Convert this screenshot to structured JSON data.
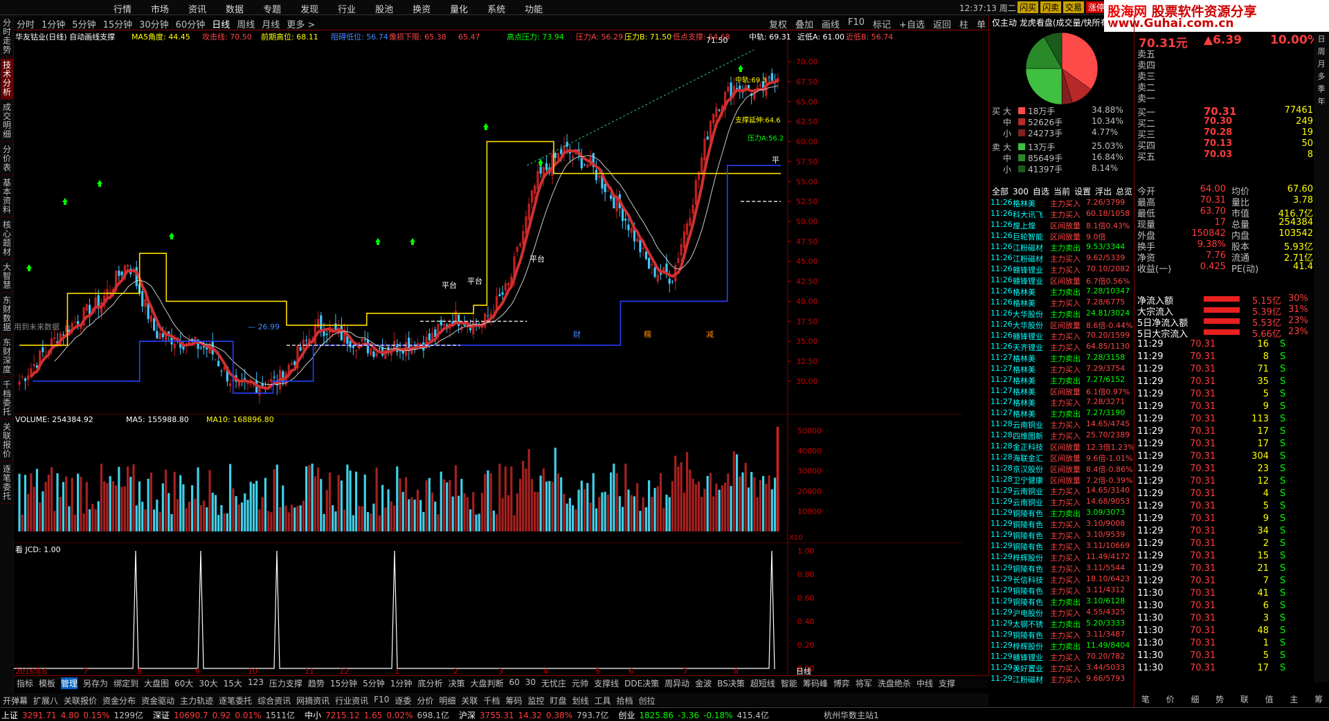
{
  "menubar": {
    "items": [
      "行情",
      "市场",
      "资讯",
      "数据",
      "专题",
      "发现",
      "行业",
      "股池",
      "换资",
      "量化",
      "系统",
      "功能"
    ],
    "clock": "12:37:13 周二",
    "buttons": [
      "闪买",
      "闪卖",
      "交易",
      "涨停买"
    ]
  },
  "logo": {
    "line1a": "股海网",
    "line1b": "股票软件资源分享",
    "line2": "www.Guhai.com.cn"
  },
  "left_tabs": [
    "分时走势",
    "技术分析",
    "成交明细",
    "分价表",
    "基本资料",
    "核心题材",
    "大智慧",
    "东财数据",
    "东财深度",
    "千档委托",
    "关联报价",
    "逐笔委托"
  ],
  "chart_toolbar": {
    "periods": [
      "分时",
      "1分钟",
      "5分钟",
      "15分钟",
      "30分钟",
      "60分钟",
      "日线",
      "周线",
      "月线",
      "更多 >"
    ],
    "right": [
      "复权",
      "叠加",
      "画线",
      "F10",
      "标记",
      "+自选",
      "返回",
      "柱",
      "单"
    ]
  },
  "indicator_line": {
    "name": "华友钴业(日线) 自动画线支撑",
    "ma5": "MA5角度: 44.45",
    "attack": "攻击线: 70.50",
    "prev_high": "前期高位: 68.11",
    "pos": "阻碍低位: 56.74",
    "break": "像损下限: 65.38",
    "dn": "65.47",
    "high_press": "高点压力: 73.94",
    "pa": "压力A: 56.29",
    "pb": "压力B: 71.50",
    "low_sup": "低点支撑: 64.68",
    "mid": "中轨: 69.31",
    "near_a": "近低A: 61.00",
    "near_b": "近低B: 56.74"
  },
  "main_axis": [
    "70.00",
    "67.50",
    "65.00",
    "62.50",
    "60.00",
    "57.50",
    "55.00",
    "52.50",
    "50.00",
    "47.50",
    "45.00",
    "42.50",
    "40.00",
    "37.50",
    "35.00",
    "32.50",
    "30.00"
  ],
  "main_labels": {
    "pingtai": "平台",
    "low": "26.99",
    "high": "71.50",
    "watermark": "用到未来数据",
    "support": "支撑延伸:64.6",
    "pressA": "压力A:56.2",
    "mid": "中轨:69.3",
    "cai": "财",
    "duo": "糯",
    "jian": "减",
    "ping": "平"
  },
  "vol": {
    "title": "VOLUME: 254384.92",
    "ma5": "MA5: 155988.80",
    "ma10": "MA10: 168896.80",
    "axis": [
      "50000",
      "40000",
      "30000",
      "20000",
      "10000"
    ],
    "x10": "X10"
  },
  "jcd": {
    "title": "看  JCD: 1.00",
    "axis": [
      "1.00",
      "0.80",
      "0.60",
      "0.40",
      "0.20",
      "0.00"
    ]
  },
  "date_axis": [
    "2016年6",
    "7",
    "8",
    "9",
    "10",
    "11",
    "12",
    "1",
    "2",
    "3",
    "4",
    "5",
    "6",
    "7",
    "8"
  ],
  "date_right": "日线",
  "bottom_tools": [
    "指标",
    "模板",
    "管理",
    "另存为",
    "绑定到",
    "大盘图",
    "60大",
    "30大",
    "15大",
    "123",
    "压力支撑",
    "趋势",
    "15分钟",
    "5分钟",
    "1分钟",
    "底分析",
    "决策",
    "大盘判断",
    "60",
    "30",
    "无忧庄",
    "元帅",
    "支撑线",
    "DDE决策",
    "周异动",
    "金波",
    "BS决策",
    "超短线",
    "智能",
    "筹码峰",
    "博弈",
    "将军",
    "洗盘绝杀",
    "中线",
    "支撑"
  ],
  "bottom_tools2": [
    "开弹幕",
    "扩展八",
    "关联报价",
    "资金分布",
    "资金驱动",
    "主力轨迹",
    "逐笔委托",
    "综合资讯",
    "网摘资讯",
    "行业资讯",
    "F10",
    "逐委",
    "分价",
    "明细",
    "关联",
    "千档",
    "筹码",
    "监控",
    "盯盘",
    "划线",
    "工具",
    "拾档",
    "创拉"
  ],
  "pie": {
    "title": "仅主动 龙虎看盘(成交量/快所有)",
    "buy_label": "买",
    "sell_label": "卖",
    "buy": [
      {
        "k": "大",
        "v": "18万手",
        "p": "34.88%"
      },
      {
        "k": "中",
        "v": "52626手",
        "p": "10.34%"
      },
      {
        "k": "小",
        "v": "24273手",
        "p": "4.77%"
      }
    ],
    "sell": [
      {
        "k": "大",
        "v": "13万手",
        "p": "25.03%"
      },
      {
        "k": "中",
        "v": "85649手",
        "p": "16.84%"
      },
      {
        "k": "小",
        "v": "41397手",
        "p": "8.14%"
      }
    ],
    "colors": [
      "#ff4a4a",
      "#b82828",
      "#802020",
      "#40c040",
      "#2a8a2a",
      "#1a5a1a"
    ]
  },
  "news_tabs": [
    "全部",
    "300",
    "自选",
    "当前",
    "设置",
    "浮出",
    "总览"
  ],
  "news": [
    [
      "11:26",
      "格林美",
      "主力买入",
      "7.26/3799"
    ],
    [
      "11:26",
      "科大讯飞",
      "主力买入",
      "60.18/1058"
    ],
    [
      "11:26",
      "煌上煌",
      "区间放量",
      "8.1倍0.43%"
    ],
    [
      "11:26",
      "巨轮智能",
      "区间放量",
      "9.0倍"
    ],
    [
      "11:26",
      "江粉磁材",
      "主力卖出",
      "9.53/3344"
    ],
    [
      "11:26",
      "江粉磁材",
      "主力买入",
      "9.62/5339"
    ],
    [
      "11:26",
      "赣锋锂业",
      "主力买入",
      "70.10/2082"
    ],
    [
      "11:26",
      "赣锋锂业",
      "区间放量",
      "6.7倍0.56%"
    ],
    [
      "11:26",
      "格林美",
      "主力卖出",
      "7.28/10347"
    ],
    [
      "11:26",
      "格林美",
      "主力买入",
      "7.28/6775"
    ],
    [
      "11:26",
      "大华股份",
      "主力卖出",
      "24.81/3024"
    ],
    [
      "11:26",
      "大华股份",
      "区间放量",
      "8.6倍-0.44%"
    ],
    [
      "11:26",
      "赣锋锂业",
      "主力买入",
      "70.20/1599"
    ],
    [
      "11:26",
      "天齐锂业",
      "主力买入",
      "64.85/1130"
    ],
    [
      "11:27",
      "格林美",
      "主力卖出",
      "7.28/3158"
    ],
    [
      "11:27",
      "格林美",
      "主力买入",
      "7.29/3754"
    ],
    [
      "11:27",
      "格林美",
      "主力卖出",
      "7.27/6152"
    ],
    [
      "11:27",
      "格林美",
      "区间放量",
      "6.1倍0.97%"
    ],
    [
      "11:27",
      "格林美",
      "主力买入",
      "7.28/3271"
    ],
    [
      "11:27",
      "格林美",
      "主力卖出",
      "7.27/3190"
    ],
    [
      "11:28",
      "云南铜业",
      "主力买入",
      "14.65/4745"
    ],
    [
      "11:28",
      "四维图新",
      "主力买入",
      "25.70/2389"
    ],
    [
      "11:28",
      "金正科技",
      "区间放量",
      "12.3倍1.23%"
    ],
    [
      "11:28",
      "海联金汇",
      "区间放量",
      "9.6倍-1.01%"
    ],
    [
      "11:28",
      "京汉股份",
      "区间放量",
      "8.4倍-0.86%"
    ],
    [
      "11:28",
      "卫宁健康",
      "区间放量",
      "7.2倍-0.39%"
    ],
    [
      "11:29",
      "云南铜业",
      "主力买入",
      "14.65/3140"
    ],
    [
      "11:29",
      "云南铜业",
      "主力买入",
      "14.68/9053"
    ],
    [
      "11:29",
      "铜陵有色",
      "主力卖出",
      "3.09/3073"
    ],
    [
      "11:29",
      "铜陵有色",
      "主力买入",
      "3.10/9008"
    ],
    [
      "11:29",
      "铜陵有色",
      "主力买入",
      "3.10/9539"
    ],
    [
      "11:29",
      "铜陵有色",
      "主力买入",
      "3.11/10669"
    ],
    [
      "11:29",
      "梓辉股份",
      "主力买入",
      "11.49/4172"
    ],
    [
      "11:29",
      "铜陵有色",
      "主力买入",
      "3.11/5544"
    ],
    [
      "11:29",
      "长信科技",
      "主力买入",
      "18.10/6423"
    ],
    [
      "11:29",
      "铜陵有色",
      "主力买入",
      "3.11/4312"
    ],
    [
      "11:29",
      "铜陵有色",
      "主力卖出",
      "3.10/6128"
    ],
    [
      "11:29",
      "沪电股份",
      "主力买入",
      "4.55/4325"
    ],
    [
      "11:29",
      "太钢不锈",
      "主力卖出",
      "5.20/3333"
    ],
    [
      "11:29",
      "铜陵有色",
      "主力买入",
      "3.11/3487"
    ],
    [
      "11:29",
      "梓辉股份",
      "主力卖出",
      "11.49/8404"
    ],
    [
      "11:29",
      "赣锋锂业",
      "主力买入",
      "70.20/782"
    ],
    [
      "11:29",
      "美好置业",
      "主力买入",
      "3.44/5033"
    ],
    [
      "11:29",
      "江粉磁材",
      "主力买入",
      "9.66/5793"
    ]
  ],
  "quote": {
    "name": "华",
    "price": "70.31元",
    "change": "▲6.39",
    "pct": "10.00%"
  },
  "asks": [
    [
      "卖五",
      "",
      ""
    ],
    [
      "卖四",
      "",
      ""
    ],
    [
      "卖三",
      "",
      ""
    ],
    [
      "卖二",
      "",
      ""
    ],
    [
      "卖一",
      "",
      ""
    ]
  ],
  "bids": [
    [
      "买一",
      "70.31",
      "77461"
    ],
    [
      "买二",
      "70.30",
      "249"
    ],
    [
      "买三",
      "70.28",
      "19"
    ],
    [
      "买四",
      "70.13",
      "50"
    ],
    [
      "买五",
      "70.03",
      "8"
    ]
  ],
  "stats": [
    [
      "今开",
      "64.00",
      "均价",
      "67.60"
    ],
    [
      "最高",
      "70.31",
      "量比",
      "3.78"
    ],
    [
      "最低",
      "63.70",
      "市值",
      "416.7亿"
    ],
    [
      "现量",
      "17",
      "总量",
      "254384"
    ],
    [
      "外盘",
      "150842",
      "内盘",
      "103542"
    ],
    [
      "换手",
      "9.38%",
      "股本",
      "5.93亿"
    ],
    [
      "净资",
      "7.76",
      "流通",
      "2.71亿"
    ],
    [
      "收益(一)",
      "0.425",
      "PE(动)",
      "41.4"
    ]
  ],
  "flows": [
    [
      "净流入额",
      "5.15亿",
      "30%"
    ],
    [
      "大宗流入",
      "5.39亿",
      "31%"
    ],
    [
      "5日净流入额",
      "5.53亿",
      "23%"
    ],
    [
      "5日大宗流入",
      "5.66亿",
      "23%"
    ]
  ],
  "ticks": [
    [
      "11:29",
      "70.31",
      "16",
      "S"
    ],
    [
      "11:29",
      "70.31",
      "8",
      "S"
    ],
    [
      "11:29",
      "70.31",
      "71",
      "S"
    ],
    [
      "11:29",
      "70.31",
      "35",
      "S"
    ],
    [
      "11:29",
      "70.31",
      "5",
      "S"
    ],
    [
      "11:29",
      "70.31",
      "9",
      "S"
    ],
    [
      "11:29",
      "70.31",
      "113",
      "S"
    ],
    [
      "11:29",
      "70.31",
      "17",
      "S"
    ],
    [
      "11:29",
      "70.31",
      "17",
      "S"
    ],
    [
      "11:29",
      "70.31",
      "304",
      "S"
    ],
    [
      "11:29",
      "70.31",
      "23",
      "S"
    ],
    [
      "11:29",
      "70.31",
      "12",
      "S"
    ],
    [
      "11:29",
      "70.31",
      "4",
      "S"
    ],
    [
      "11:29",
      "70.31",
      "5",
      "S"
    ],
    [
      "11:29",
      "70.31",
      "9",
      "S"
    ],
    [
      "11:29",
      "70.31",
      "34",
      "S"
    ],
    [
      "11:29",
      "70.31",
      "2",
      "S"
    ],
    [
      "11:29",
      "70.31",
      "15",
      "S"
    ],
    [
      "11:29",
      "70.31",
      "21",
      "S"
    ],
    [
      "11:29",
      "70.31",
      "7",
      "S"
    ],
    [
      "11:30",
      "70.31",
      "41",
      "S"
    ],
    [
      "11:30",
      "70.31",
      "6",
      "S"
    ],
    [
      "11:30",
      "70.31",
      "3",
      "S"
    ],
    [
      "11:30",
      "70.31",
      "48",
      "S"
    ],
    [
      "11:30",
      "70.31",
      "1",
      "S"
    ],
    [
      "11:30",
      "70.31",
      "5",
      "S"
    ],
    [
      "11:30",
      "70.31",
      "17",
      "S"
    ]
  ],
  "right_bottom_tabs": [
    "监控",
    "关联",
    "分笔",
    "分价",
    "直播"
  ],
  "right_bottom_tabs2": [
    "笔",
    "价",
    "细",
    "势",
    "联",
    "值",
    "主",
    "筹"
  ],
  "right_side": [
    "日",
    "周",
    "月",
    "多",
    "季",
    "年"
  ],
  "status": [
    [
      "上证",
      "3291.71",
      "4.80",
      "0.15%",
      "1299亿"
    ],
    [
      "深证",
      "10690.7",
      "0.92",
      "0.01%",
      "1511亿"
    ],
    [
      "中小",
      "7215.12",
      "1.65",
      "0.02%",
      "698.1亿"
    ],
    [
      "沪深",
      "3755.31",
      "14.32",
      "0.38%",
      "793.7亿"
    ],
    [
      "创业",
      "1825.86",
      "-3.36",
      "-0.18%",
      "415.4亿"
    ]
  ],
  "status_end": "杭州华数主站1"
}
